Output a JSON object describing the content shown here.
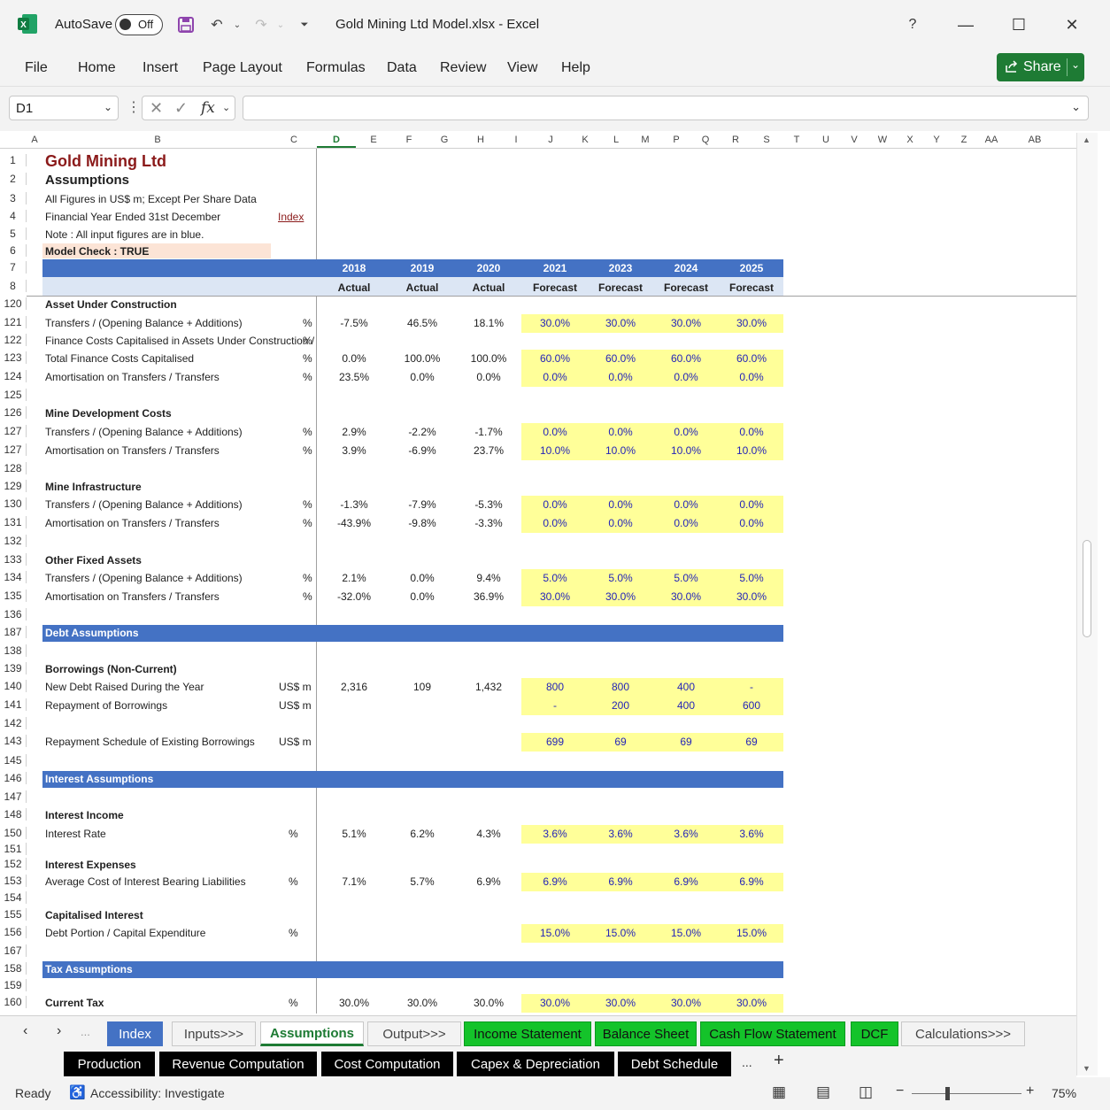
{
  "window": {
    "autosave_label": "AutoSave",
    "autosave_state": "Off",
    "title": "Gold Mining Ltd Model.xlsx  -  Excel",
    "help": "?"
  },
  "ribbon": {
    "tabs": [
      "File",
      "Home",
      "Insert",
      "Page Layout",
      "Formulas",
      "Data",
      "Review",
      "View",
      "Help"
    ],
    "share_label": "Share"
  },
  "formula_bar": {
    "name_box": "D1",
    "fx": "fx",
    "value": ""
  },
  "columns": [
    "A",
    "B",
    "C",
    "D",
    "E",
    "F",
    "G",
    "H",
    "I",
    "J",
    "K",
    "L",
    "M",
    "P",
    "Q",
    "R",
    "S",
    "T",
    "U",
    "V",
    "W",
    "X",
    "Y",
    "Z",
    "AA",
    "AB"
  ],
  "selected_column": "D",
  "header": {
    "company": "Gold Mining Ltd",
    "sheet_title": "Assumptions",
    "note1": "All Figures in US$ m; Except Per Share Data",
    "note2": "Financial Year Ended 31st December",
    "index_link": "Index",
    "note3": "Note : All input figures are in blue.",
    "model_check": "Model Check : TRUE",
    "years": [
      "2018",
      "2019",
      "2020",
      "2021",
      "2023",
      "2024",
      "2025"
    ],
    "types": [
      "Actual",
      "Actual",
      "Actual",
      "Forecast",
      "Forecast",
      "Forecast",
      "Forecast"
    ]
  },
  "row_numbers_top": [
    "1",
    "2",
    "3",
    "4",
    "5",
    "6",
    "7",
    "8"
  ],
  "rows": [
    {
      "n": "120",
      "label": "Asset Under Construction",
      "bold": true,
      "unit": "",
      "vals": []
    },
    {
      "n": "121",
      "label": "Transfers / (Opening Balance + Additions)",
      "unit": "%",
      "vals": [
        "-7.5%",
        "46.5%",
        "18.1%",
        "30.0%",
        "30.0%",
        "30.0%",
        "30.0%"
      ]
    },
    {
      "n": "122",
      "label": "Finance Costs Capitalised in Assets Under Construction /",
      "unit": "%",
      "vals": []
    },
    {
      "n": "123",
      "label": "Total Finance Costs Capitalised",
      "unit": "%",
      "vals": [
        "0.0%",
        "100.0%",
        "100.0%",
        "60.0%",
        "60.0%",
        "60.0%",
        "60.0%"
      ]
    },
    {
      "n": "124",
      "label": "Amortisation on Transfers / Transfers",
      "unit": "%",
      "vals": [
        "23.5%",
        "0.0%",
        "0.0%",
        "0.0%",
        "0.0%",
        "0.0%",
        "0.0%"
      ]
    },
    {
      "n": "125",
      "label": "",
      "unit": "",
      "vals": []
    },
    {
      "n": "126",
      "label": "Mine Development Costs",
      "bold": true,
      "unit": "",
      "vals": []
    },
    {
      "n": "127",
      "label": "Transfers / (Opening Balance + Additions)",
      "unit": "%",
      "vals": [
        "2.9%",
        "-2.2%",
        "-1.7%",
        "0.0%",
        "0.0%",
        "0.0%",
        "0.0%"
      ]
    },
    {
      "n": "127",
      "label": "Amortisation on Transfers / Transfers",
      "unit": "%",
      "vals": [
        "3.9%",
        "-6.9%",
        "23.7%",
        "10.0%",
        "10.0%",
        "10.0%",
        "10.0%"
      ]
    },
    {
      "n": "128",
      "label": "",
      "unit": "",
      "vals": []
    },
    {
      "n": "129",
      "label": "Mine Infrastructure",
      "bold": true,
      "unit": "",
      "vals": []
    },
    {
      "n": "130",
      "label": "Transfers / (Opening Balance + Additions)",
      "unit": "%",
      "vals": [
        "-1.3%",
        "-7.9%",
        "-5.3%",
        "0.0%",
        "0.0%",
        "0.0%",
        "0.0%"
      ]
    },
    {
      "n": "131",
      "label": "Amortisation on Transfers / Transfers",
      "unit": "%",
      "vals": [
        "-43.9%",
        "-9.8%",
        "-3.3%",
        "0.0%",
        "0.0%",
        "0.0%",
        "0.0%"
      ]
    },
    {
      "n": "132",
      "label": "",
      "unit": "",
      "vals": []
    },
    {
      "n": "133",
      "label": "Other Fixed Assets",
      "bold": true,
      "unit": "",
      "vals": []
    },
    {
      "n": "134",
      "label": "Transfers / (Opening Balance + Additions)",
      "unit": "%",
      "vals": [
        "2.1%",
        "0.0%",
        "9.4%",
        "5.0%",
        "5.0%",
        "5.0%",
        "5.0%"
      ]
    },
    {
      "n": "135",
      "label": "Amortisation on Transfers / Transfers",
      "unit": "%",
      "vals": [
        "-32.0%",
        "0.0%",
        "36.9%",
        "30.0%",
        "30.0%",
        "30.0%",
        "30.0%"
      ]
    },
    {
      "n": "136",
      "label": "",
      "unit": "",
      "vals": []
    },
    {
      "n": "187",
      "label": "Debt Assumptions",
      "band": true,
      "unit": "",
      "vals": []
    },
    {
      "n": "138",
      "label": "",
      "unit": "",
      "vals": []
    },
    {
      "n": "139",
      "label": "Borrowings (Non-Current)",
      "bold": true,
      "unit": "",
      "vals": []
    },
    {
      "n": "140",
      "label": "New Debt Raised During the Year",
      "unit": "US$ m",
      "vals": [
        "2,316",
        "109",
        "1,432",
        "800",
        "800",
        "400",
        "-"
      ]
    },
    {
      "n": "141",
      "label": "Repayment of Borrowings",
      "unit": "US$ m",
      "vals": [
        "",
        "",
        "",
        "-",
        "200",
        "400",
        "600"
      ]
    },
    {
      "n": "142",
      "label": "",
      "unit": "",
      "vals": []
    },
    {
      "n": "143",
      "label": "Repayment Schedule of Existing Borrowings",
      "unit": "US$ m",
      "vals": [
        "",
        "",
        "",
        "699",
        "69",
        "69",
        "69"
      ]
    },
    {
      "n": "145",
      "label": "",
      "unit": "",
      "vals": []
    },
    {
      "n": "146",
      "label": "Interest Assumptions",
      "band": true,
      "unit": "",
      "vals": []
    },
    {
      "n": "147",
      "label": "",
      "unit": "",
      "vals": []
    },
    {
      "n": "148",
      "label": "Interest Income",
      "bold": true,
      "unit": "",
      "vals": []
    },
    {
      "n": "150",
      "label": "Interest Rate",
      "unit": "%",
      "vals": [
        "5.1%",
        "6.2%",
        "4.3%",
        "3.6%",
        "3.6%",
        "3.6%",
        "3.6%"
      ]
    },
    {
      "n": "151",
      "label": "",
      "unit": "",
      "vals": []
    },
    {
      "n": "152",
      "label": "Interest Expenses",
      "bold": true,
      "unit": "",
      "vals": []
    },
    {
      "n": "153",
      "label": "Average Cost of Interest Bearing Liabilities",
      "unit": "%",
      "vals": [
        "7.1%",
        "5.7%",
        "6.9%",
        "6.9%",
        "6.9%",
        "6.9%",
        "6.9%"
      ]
    },
    {
      "n": "154",
      "label": "",
      "unit": "",
      "vals": []
    },
    {
      "n": "155",
      "label": "Capitalised Interest",
      "bold": true,
      "unit": "",
      "vals": []
    },
    {
      "n": "156",
      "label": "Debt Portion / Capital Expenditure",
      "unit": "%",
      "vals": [
        "",
        "",
        "",
        "15.0%",
        "15.0%",
        "15.0%",
        "15.0%"
      ]
    },
    {
      "n": "167",
      "label": "",
      "unit": "",
      "vals": []
    },
    {
      "n": "158",
      "label": "Tax Assumptions",
      "band": true,
      "unit": "",
      "vals": []
    },
    {
      "n": "159",
      "label": "",
      "unit": "",
      "vals": []
    },
    {
      "n": "160",
      "label": "Current Tax",
      "bold": true,
      "unit": "%",
      "vals": [
        "30.0%",
        "30.0%",
        "30.0%",
        "30.0%",
        "30.0%",
        "30.0%",
        "30.0%"
      ]
    }
  ],
  "sheet_tabs_row1": [
    {
      "label": "Index",
      "style": "blue"
    },
    {
      "label": "Inputs>>>",
      "style": "plain"
    },
    {
      "label": "Assumptions",
      "style": "active"
    },
    {
      "label": "Output>>>",
      "style": "plain"
    },
    {
      "label": "Income Statement",
      "style": "green"
    },
    {
      "label": "Balance Sheet",
      "style": "green"
    },
    {
      "label": "Cash Flow Statement",
      "style": "green"
    },
    {
      "label": "DCF",
      "style": "green"
    },
    {
      "label": "Calculations>>>",
      "style": "plain"
    }
  ],
  "sheet_tabs_row2": [
    "Production",
    "Revenue Computation",
    "Cost Computation",
    "Capex & Depreciation",
    "Debt Schedule"
  ],
  "tab_more": "...",
  "tab_add": "+",
  "status": {
    "ready": "Ready",
    "accessibility": "Accessibility: Investigate",
    "zoom": "75%"
  },
  "colors": {
    "band": "#4472c4",
    "input_fill": "#ffff99",
    "input_text": "#2424b8",
    "tab_green": "#14c32a",
    "tab_blue": "#4472c4",
    "model_check_fill": "#fce4d6",
    "title_red": "#8b1a1a"
  }
}
